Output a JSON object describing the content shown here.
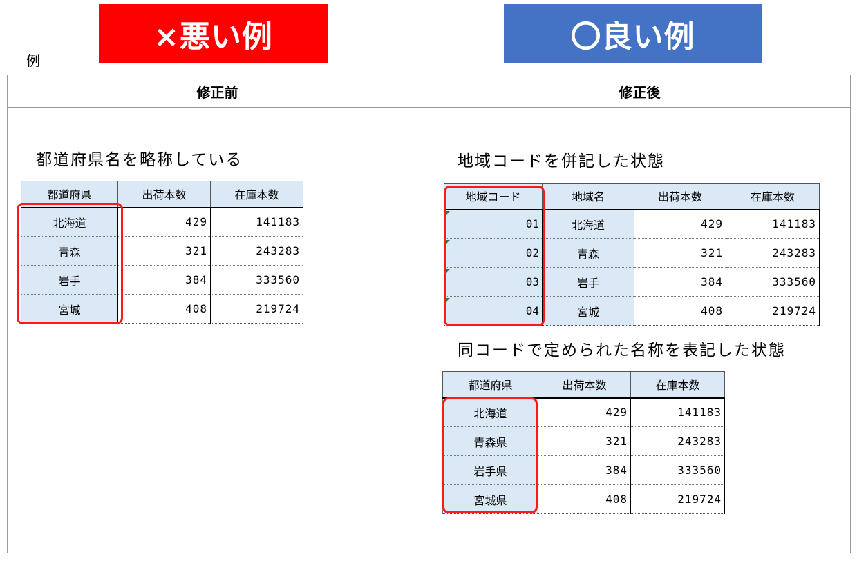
{
  "banners": {
    "bad": "×悪い例",
    "good": "〇良い例"
  },
  "example_label": "例",
  "headers": {
    "before": "修正前",
    "after": "修正後"
  },
  "before": {
    "caption": "都道府県名を略称している",
    "columns": [
      "都道府県",
      "出荷本数",
      "在庫本数"
    ],
    "rows": [
      [
        "北海道",
        "429",
        "141183"
      ],
      [
        "青森",
        "321",
        "243283"
      ],
      [
        "岩手",
        "384",
        "333560"
      ],
      [
        "宮城",
        "408",
        "219724"
      ]
    ]
  },
  "after_code": {
    "caption": "地域コードを併記した状態",
    "columns": [
      "地域コード",
      "地域名",
      "出荷本数",
      "在庫本数"
    ],
    "rows": [
      [
        "01",
        "北海道",
        "429",
        "141183"
      ],
      [
        "02",
        "青森",
        "321",
        "243283"
      ],
      [
        "03",
        "岩手",
        "384",
        "333560"
      ],
      [
        "04",
        "宮城",
        "408",
        "219724"
      ]
    ]
  },
  "after_name": {
    "caption": "同コードで定められた名称を表記した状態",
    "columns": [
      "都道府県",
      "出荷本数",
      "在庫本数"
    ],
    "rows": [
      [
        "北海道",
        "429",
        "141183"
      ],
      [
        "青森県",
        "321",
        "243283"
      ],
      [
        "岩手県",
        "384",
        "333560"
      ],
      [
        "宮城県",
        "408",
        "219724"
      ]
    ]
  },
  "colors": {
    "bad_banner": "#ff0000",
    "good_banner": "#4472c4",
    "highlight": "#ff1a1a",
    "header_fill": "#dbe8f5"
  }
}
